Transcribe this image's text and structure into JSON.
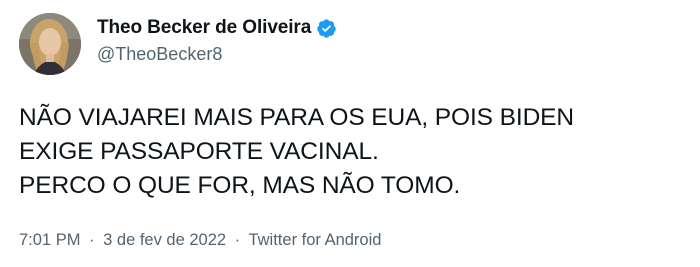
{
  "author": {
    "display_name": "Theo Becker de Oliveira",
    "handle": "@TheoBecker8",
    "verified": true,
    "avatar_icon": "profile-photo"
  },
  "tweet": {
    "lines": [
      "NÃO VIAJAREI MAIS PARA OS EUA, POIS BIDEN",
      "EXIGE PASSAPORTE VACINAL.",
      "PERCO O QUE FOR, MAS NÃO TOMO."
    ],
    "time": "7:01 PM",
    "separator": "·",
    "date": "3 de fev de 2022",
    "source": "Twitter for Android"
  },
  "colors": {
    "text": "#0f1419",
    "secondary": "#536471",
    "verified_badge": "#1d9bf0"
  }
}
